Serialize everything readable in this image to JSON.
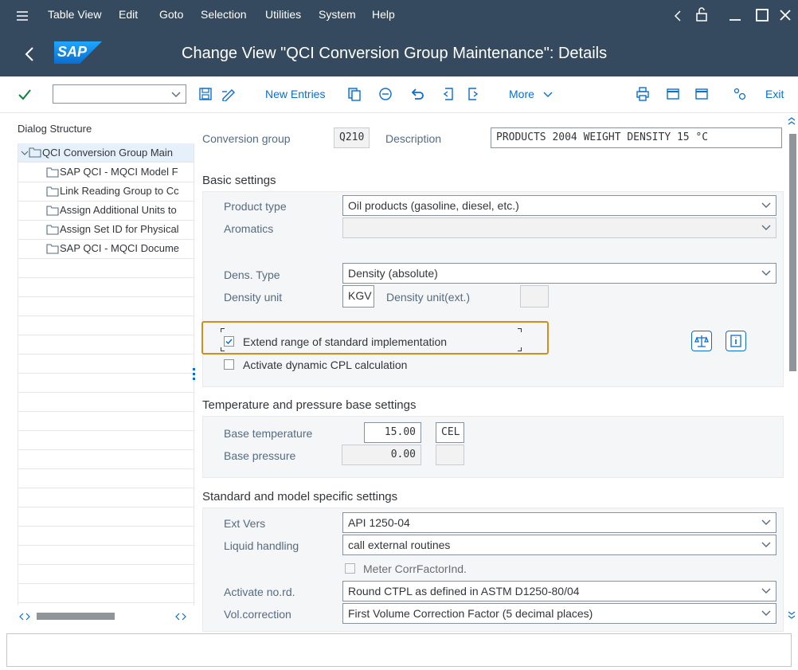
{
  "menu": {
    "items": [
      "Table View",
      "Edit",
      "Goto",
      "Selection",
      "Utilities",
      "System",
      "Help"
    ]
  },
  "titlebar": {
    "logo": "SAP",
    "title": "Change View \"QCI Conversion Group Maintenance\": Details"
  },
  "toolbar": {
    "command_value": "",
    "new_entries": "New Entries",
    "more": "More",
    "exit": "Exit"
  },
  "tree": {
    "header": "Dialog Structure",
    "root": "QCI Conversion Group Main",
    "children": [
      "SAP QCI - MQCI Model F",
      "Link Reading Group to Cc",
      "Assign Additional Units to",
      "Assign Set ID for Physical",
      "SAP QCI - MQCI Docume"
    ]
  },
  "header_fields": {
    "conversion_group_label": "Conversion group",
    "conversion_group_value": "Q210",
    "description_label": "Description",
    "description_value": "PRODUCTS 2004 WEIGHT DENSITY 15 °C"
  },
  "basic": {
    "title": "Basic settings",
    "product_type_label": "Product type",
    "product_type_value": "Oil products (gasoline, diesel, etc.)",
    "aromatics_label": "Aromatics",
    "aromatics_value": "",
    "dens_type_label": "Dens. Type",
    "dens_type_value": "Density (absolute)",
    "density_unit_label": "Density unit",
    "density_unit_value": "KGV",
    "density_unit_ext_label": "Density unit(ext.)",
    "density_unit_ext_value": "",
    "extend_range_label": "Extend range of standard implementation",
    "extend_range_checked": true,
    "dynamic_cpl_label": "Activate dynamic CPL calculation",
    "dynamic_cpl_checked": false
  },
  "temp": {
    "title": "Temperature and pressure base settings",
    "base_temp_label": "Base temperature",
    "base_temp_value": "15.00",
    "base_temp_unit": "CEL",
    "base_pressure_label": "Base pressure",
    "base_pressure_value": "0.00",
    "base_pressure_unit": ""
  },
  "standard": {
    "title": "Standard and model specific settings",
    "ext_vers_label": "Ext Vers",
    "ext_vers_value": "API 1250-04",
    "liquid_label": "Liquid handling",
    "liquid_value": "call external routines",
    "meter_label": "Meter CorrFactorInd.",
    "meter_checked": false,
    "activate_label": "Activate no.rd.",
    "activate_value": "Round CTPL as defined in ASTM D1250-80/04",
    "volcorr_label": "Vol.correction",
    "volcorr_value": "First Volume Correction Factor (5 decimal places)"
  },
  "colors": {
    "shell": "#354a5f",
    "accent": "#0a6ed1",
    "highlight": "#d08f1a"
  }
}
